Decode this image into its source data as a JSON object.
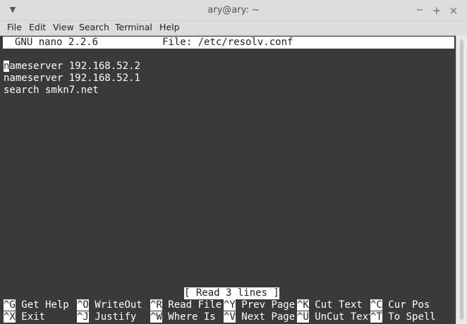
{
  "window": {
    "title": "ary@ary: ~",
    "menu_arrow_icon": "chevron-down-icon",
    "minimize_label": "−",
    "maximize_label": "+",
    "close_label": "×"
  },
  "menubar": {
    "items": [
      "File",
      "Edit",
      "View",
      "Search",
      "Terminal",
      "Help"
    ]
  },
  "nano": {
    "version": "GNU nano 2.2.6",
    "file_label": "File: /etc/resolv.conf",
    "cursor_char": "n",
    "lines": [
      "ameserver 192.168.52.2",
      "nameserver 192.168.52.1",
      "search smkn7.net"
    ],
    "status": "[ Read 3 lines ]",
    "shortcuts_row1": [
      {
        "key": "^G",
        "label": "Get Help"
      },
      {
        "key": "^O",
        "label": "WriteOut"
      },
      {
        "key": "^R",
        "label": "Read File"
      },
      {
        "key": "^Y",
        "label": "Prev Page"
      },
      {
        "key": "^K",
        "label": "Cut Text"
      },
      {
        "key": "^C",
        "label": "Cur Pos"
      }
    ],
    "shortcuts_row2": [
      {
        "key": "^X",
        "label": "Exit"
      },
      {
        "key": "^J",
        "label": "Justify"
      },
      {
        "key": "^W",
        "label": "Where Is"
      },
      {
        "key": "^V",
        "label": "Next Page"
      },
      {
        "key": "^U",
        "label": "UnCut Text"
      },
      {
        "key": "^T",
        "label": "To Spell"
      }
    ]
  },
  "colors": {
    "terminal_bg": "#3a3a3a",
    "chrome_bg": "#dcdcdc",
    "text": "#ffffff"
  }
}
